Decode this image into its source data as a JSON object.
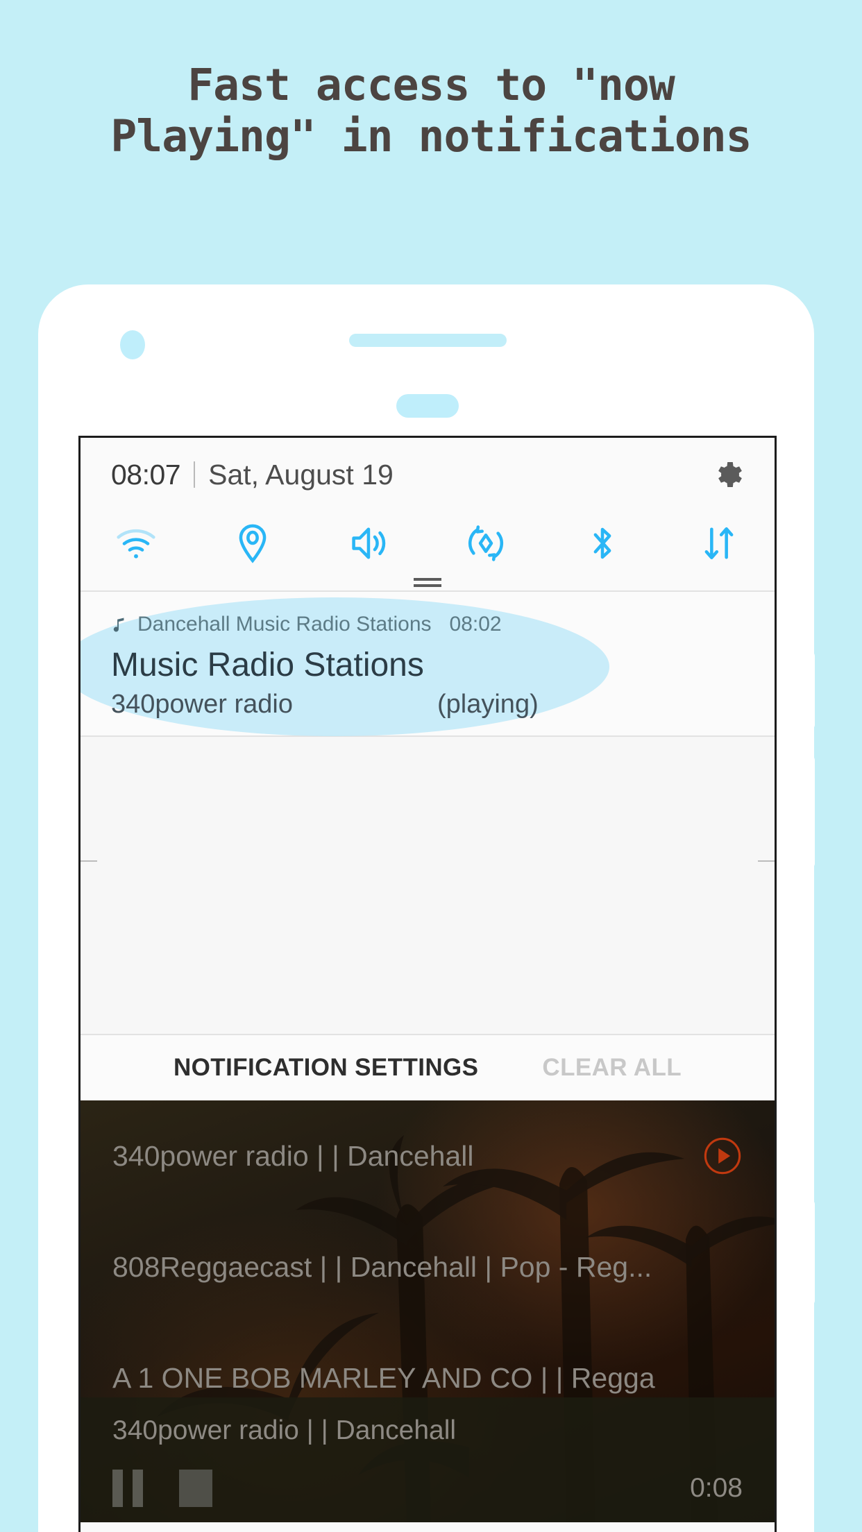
{
  "promo": {
    "headline": "Fast access to \"now\nPlaying\" in notifications",
    "background_color": "#c4eff7",
    "headline_color": "#4c4441",
    "highlight_color": "#bfe9f8"
  },
  "phone": {
    "camera_icon": "camera-dot",
    "speaker_icon": "earpiece-speaker",
    "home_icon": "home-pill"
  },
  "status_bar": {
    "time": "08:07",
    "date": "Sat, August 19",
    "settings_icon": "gear-icon"
  },
  "quick_settings": {
    "tint": "#29b6f6",
    "tiles": [
      {
        "name": "wifi-icon",
        "label": "Wi-Fi"
      },
      {
        "name": "location-icon",
        "label": "Location"
      },
      {
        "name": "sound-icon",
        "label": "Sound"
      },
      {
        "name": "auto-rotate-icon",
        "label": "Auto rotate"
      },
      {
        "name": "bluetooth-icon",
        "label": "Bluetooth"
      },
      {
        "name": "mobile-data-icon",
        "label": "Data"
      }
    ]
  },
  "notification": {
    "app_icon": "music-note-icon",
    "app_name": "Dancehall Music Radio Stations",
    "time": "08:02",
    "title": "Music Radio Stations",
    "subtitle": "340power radio",
    "state": "(playing)"
  },
  "shade_actions": {
    "primary": "NOTIFICATION SETTINGS",
    "secondary": "CLEAR ALL"
  },
  "app": {
    "stations": [
      {
        "name": "340power radio | | Dancehall",
        "play_icon": "play-circle-icon"
      },
      {
        "name": "808Reggaecast | | Dancehall | Pop - Reg...",
        "play_icon": ""
      },
      {
        "name": "A 1 ONE BOB MARLEY AND CO | | Regga",
        "play_icon": ""
      }
    ],
    "player": {
      "title": "340power radio | | Dancehall",
      "pause_icon": "pause-icon",
      "stop_icon": "stop-icon",
      "elapsed": "0:08",
      "accent_color": "#c0390f"
    }
  }
}
